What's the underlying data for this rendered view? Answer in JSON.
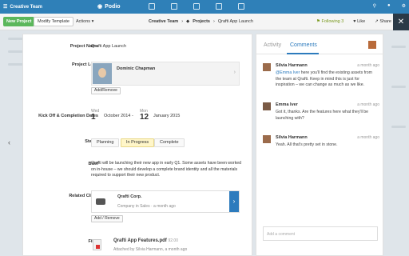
{
  "topbar": {
    "workspace": "Creative Team",
    "app_logo": "Podio",
    "following_label": "Following",
    "following_count": "3",
    "like_label": "Like",
    "share_label": "Share"
  },
  "toolbar": {
    "new_project": "New Project",
    "modify_template": "Modify Template",
    "actions": "Actions",
    "breadcrumb": [
      "Creative Team",
      "Projects",
      "Qrafti App Launch"
    ]
  },
  "project": {
    "name_label": "Project Name",
    "name_value": "Qrafti App Launch",
    "lead_label": "Project Lead",
    "lead_name": "Dominic Chapman",
    "add_remove": "Add/Remove",
    "kickoff_label": "Kick Off & Completion Dates",
    "start": {
      "weekday": "Wed",
      "day": "1",
      "month_year": "October 2014"
    },
    "end": {
      "weekday": "Mon",
      "day": "12",
      "month_year": "January 2015"
    },
    "date_sep": "-",
    "status_label": "Status",
    "status_options": [
      "Planning",
      "In Progress",
      "Complete"
    ],
    "status_selected": "In Progress",
    "brief_label": "Brief",
    "brief_text": "Qrafti will be launching their new app in early Q1. Some assets have been worked on in-house – we should develop a complete brand identity and all the materials required to support their new product.",
    "client_label": "Related Client",
    "client_name": "Qrafti Corp.",
    "client_sub": "Company in Sales · a month ago",
    "client_add_remove": "Add / Remove",
    "files_label": "Files",
    "file_name": "Qrafti App Features.pdf",
    "file_size": "92.00",
    "file_sub": "Attached by Silvia Harmann, a month ago"
  },
  "side": {
    "tab_activity": "Activity",
    "tab_comments": "Comments",
    "comments": [
      {
        "name": "Silvia Harmann",
        "time": "a month ago",
        "mention": "@Emma Iver",
        "text": " here you'll find the existing assets from the team at Qrafti. Keep in mind this is just for inspiration – we can change as much as we like."
      },
      {
        "name": "Emma Iver",
        "time": "a month ago",
        "mention": "",
        "text": "Got it, thanks. Are the features here what they'll be launching with?"
      },
      {
        "name": "Silvia Harmann",
        "time": "a month ago",
        "mention": "",
        "text": "Yeah. All that's pretty set in stone."
      }
    ],
    "add_comment_placeholder": "Add a comment"
  }
}
